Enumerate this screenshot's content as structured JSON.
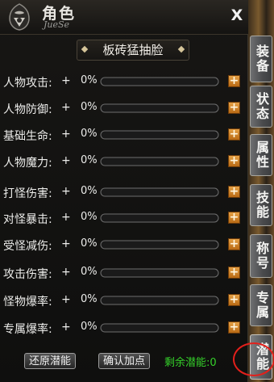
{
  "header": {
    "title": "角色",
    "subtitle": "JueSe",
    "close_label": "X"
  },
  "banner": "板砖猛抽脸",
  "attributes": [
    {
      "label": "人物攻击:",
      "plus": "+",
      "value": "0%",
      "fill": 0
    },
    {
      "label": "人物防御:",
      "plus": "+",
      "value": "0%",
      "fill": 0
    },
    {
      "label": "基础生命:",
      "plus": "+",
      "value": "0%",
      "fill": 0
    },
    {
      "label": "人物魔力:",
      "plus": "+",
      "value": "0%",
      "fill": 0
    },
    {
      "label": "打怪伤害:",
      "plus": "+",
      "value": "0%",
      "fill": 0
    },
    {
      "label": "对怪暴击:",
      "plus": "+",
      "value": "0%",
      "fill": 0
    },
    {
      "label": "受怪减伤:",
      "plus": "+",
      "value": "0%",
      "fill": 0
    },
    {
      "label": "攻击伤害:",
      "plus": "+",
      "value": "0%",
      "fill": 0
    },
    {
      "label": "怪物爆率:",
      "plus": "+",
      "value": "0%",
      "fill": 0
    },
    {
      "label": "专属爆率:",
      "plus": "+",
      "value": "0%",
      "fill": 0
    }
  ],
  "add_button_label": "+",
  "footer": {
    "reset_label": "还原潜能",
    "confirm_label": "确认加点",
    "remaining_label": "剩余潜能:",
    "remaining_value": "0"
  },
  "tabs": [
    {
      "label": "装备",
      "active": false
    },
    {
      "label": "状态",
      "active": false
    },
    {
      "label": "属性",
      "active": false
    },
    {
      "label": "技能",
      "active": false
    },
    {
      "label": "称号",
      "active": false
    },
    {
      "label": "专属",
      "active": false
    },
    {
      "label": "潜能",
      "active": true
    }
  ],
  "colors": {
    "accent_orange": "#d98a2b",
    "remaining_green": "#35d12a",
    "highlight_red": "#e3201b"
  }
}
